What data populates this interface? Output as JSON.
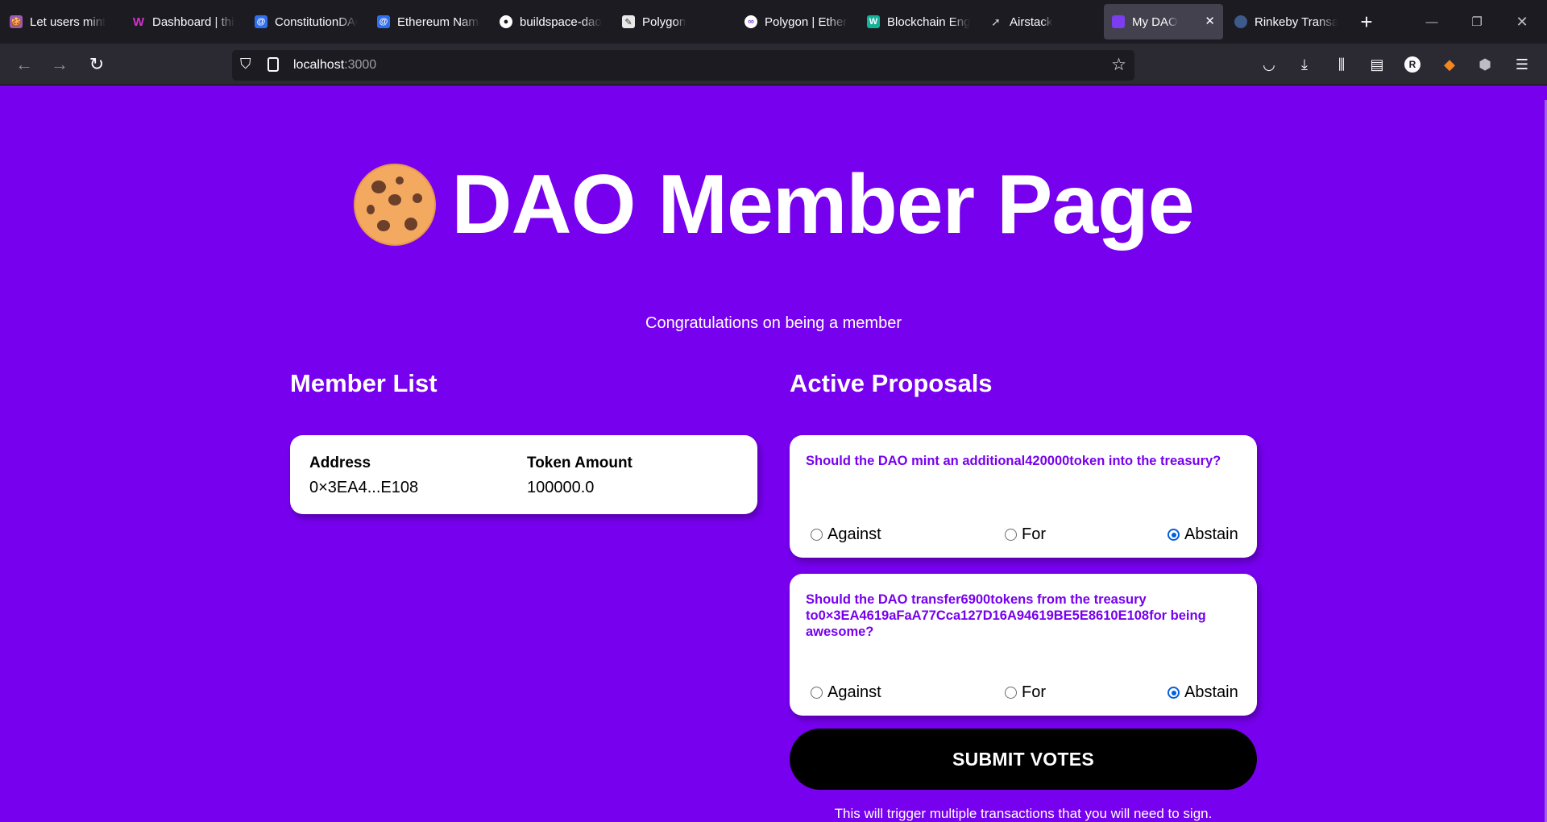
{
  "browser": {
    "tabs": [
      {
        "label": "Let users mint",
        "favicon": "unicorn-cookie-icon",
        "color": "#9b59b6"
      },
      {
        "label": "Dashboard | thirdweb",
        "favicon": "thirdweb-icon",
        "color": "#d62fd0"
      },
      {
        "label": "ConstitutionDAO",
        "favicon": "constitution-icon",
        "color": "#2f6fed"
      },
      {
        "label": "Ethereum Name Service",
        "favicon": "ens-icon",
        "color": "#2f6fed"
      },
      {
        "label": "buildspace-dao",
        "favicon": "github-icon",
        "color": "#ffffff"
      },
      {
        "label": "Polygon",
        "favicon": "polygon-doc-icon",
        "color": "#e8e8e8"
      },
      {
        "label": "Polygon | Ethereum",
        "favicon": "polygon-icon",
        "color": "#8247e5"
      },
      {
        "label": "Blockchain Engineer",
        "favicon": "blockchain-icon",
        "color": "#11b39a"
      },
      {
        "label": "Airstack",
        "favicon": "airstack-icon",
        "color": "#cccccc"
      },
      {
        "label": "My DAO",
        "favicon": "dao-icon",
        "color": "#7a3df0",
        "active": true
      },
      {
        "label": "Rinkeby Transaction",
        "favicon": "etherscan-icon",
        "color": "#3d5a8a"
      }
    ],
    "url": {
      "host": "localhost",
      "port": ":3000"
    }
  },
  "page": {
    "title": "DAO Member Page",
    "subtitle": "Congratulations on being a member",
    "member_list": {
      "heading": "Member List",
      "columns": [
        "Address",
        "Token Amount"
      ],
      "rows": [
        {
          "address": "0×3EA4...E108",
          "amount": "100000.0"
        }
      ]
    },
    "proposals": {
      "heading": "Active Proposals",
      "items": [
        {
          "question": "Should the DAO mint an additional420000token into the treasury?",
          "options": [
            "Against",
            "For",
            "Abstain"
          ],
          "selected": "Abstain"
        },
        {
          "question": "Should the DAO transfer6900tokens from the treasury to0×3EA4619aFaA77Cca127D16A94619BE5E8610E108for being awesome?",
          "options": [
            "Against",
            "For",
            "Abstain"
          ],
          "selected": "Abstain"
        }
      ]
    },
    "submit_label": "SUBMIT VOTES",
    "hint": "This will trigger multiple transactions that you will need to sign."
  },
  "colors": {
    "page_bg": "#7700ee",
    "proposal_text": "#7700ee",
    "card_bg": "#ffffff",
    "submit_bg": "#000000"
  }
}
